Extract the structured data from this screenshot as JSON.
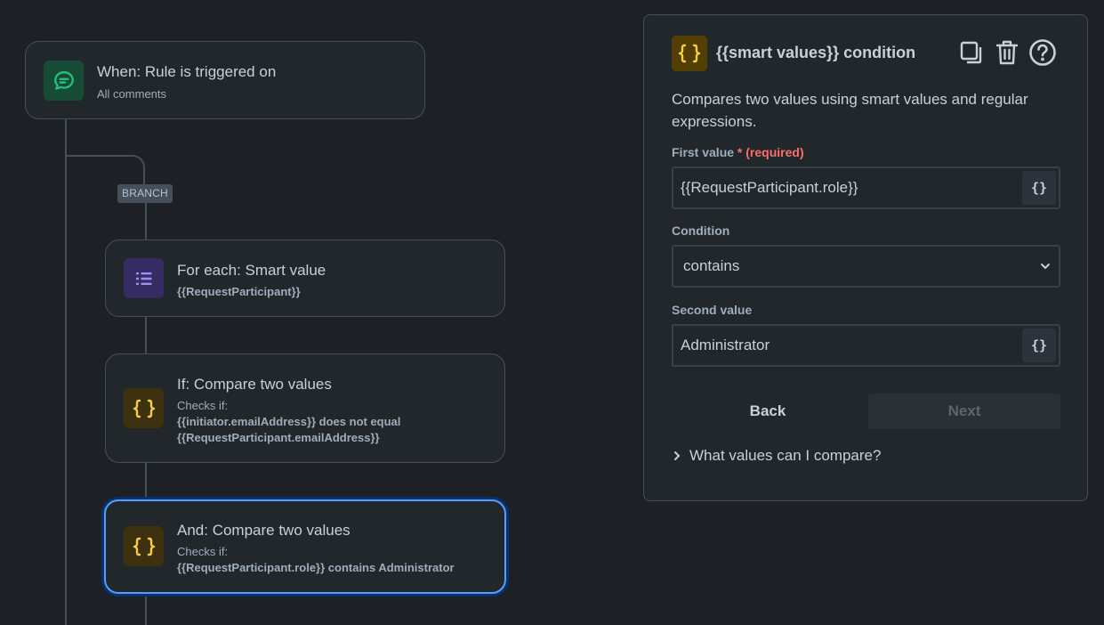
{
  "canvas": {
    "branch_label": "BRANCH",
    "trigger": {
      "title": "When: Rule is triggered on",
      "subtitle": "All comments",
      "icon": "comment-icon"
    },
    "for_each": {
      "title": "For each: Smart value",
      "subtitle": "{{RequestParticipant}}",
      "icon": "list-icon"
    },
    "if_condition": {
      "title": "If: Compare two values",
      "checks_label": "Checks if:",
      "line1": "{{initiator.emailAddress}} does not equal",
      "line2": "{{RequestParticipant.emailAddress}}",
      "icon": "smart-value-icon"
    },
    "and_condition": {
      "title": "And: Compare two values",
      "checks_label": "Checks if:",
      "line1": "{{RequestParticipant.role}} contains Administrator",
      "icon": "smart-value-icon"
    }
  },
  "panel": {
    "title": "{{smart values}} condition",
    "description": "Compares two values using smart values and regular expressions.",
    "first_value": {
      "label": "First value",
      "required_marker": "*",
      "required_text": "(required)",
      "value": "{{RequestParticipant.role}}"
    },
    "condition": {
      "label": "Condition",
      "value": "contains"
    },
    "second_value": {
      "label": "Second value",
      "value": "Administrator"
    },
    "smart_button_glyph": "{}",
    "back_label": "Back",
    "next_label": "Next",
    "expander_label": "What values can I compare?"
  },
  "colors": {
    "background": "#1d2125",
    "card": "#22272b",
    "accent_selected": "#579dff",
    "trigger_icon": "#2abb7f",
    "list_icon": "#9f8fef",
    "smart_icon": "#f5cd47",
    "required": "#f87168"
  }
}
